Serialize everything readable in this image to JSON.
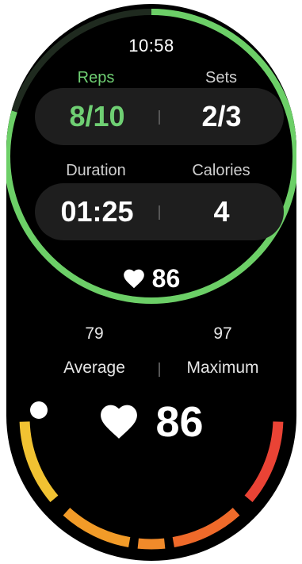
{
  "status": {
    "time": "10:58"
  },
  "ring": {
    "progress": 0.8,
    "track_color": "#1f2a1f",
    "fill_color": "#6ccf67"
  },
  "workout": {
    "reps_label": "Reps",
    "reps_value": "8/10",
    "sets_label": "Sets",
    "sets_value": "2/3",
    "duration_label": "Duration",
    "duration_value": "01:25",
    "calories_label": "Calories",
    "calories_value": "4"
  },
  "heart_rate": {
    "current": "86",
    "average_value": "79",
    "average_label": "Average",
    "maximum_value": "97",
    "maximum_label": "Maximum",
    "current_large": "86",
    "heart_icon": "heart-icon"
  },
  "zones": {
    "colors": [
      "#f1c232",
      "#f29b28",
      "#f08a2a",
      "#ef6a2a",
      "#ea4335"
    ]
  },
  "colors": {
    "accent": "#6fcf73",
    "background": "#000000",
    "pill": "#1e1e1e"
  }
}
